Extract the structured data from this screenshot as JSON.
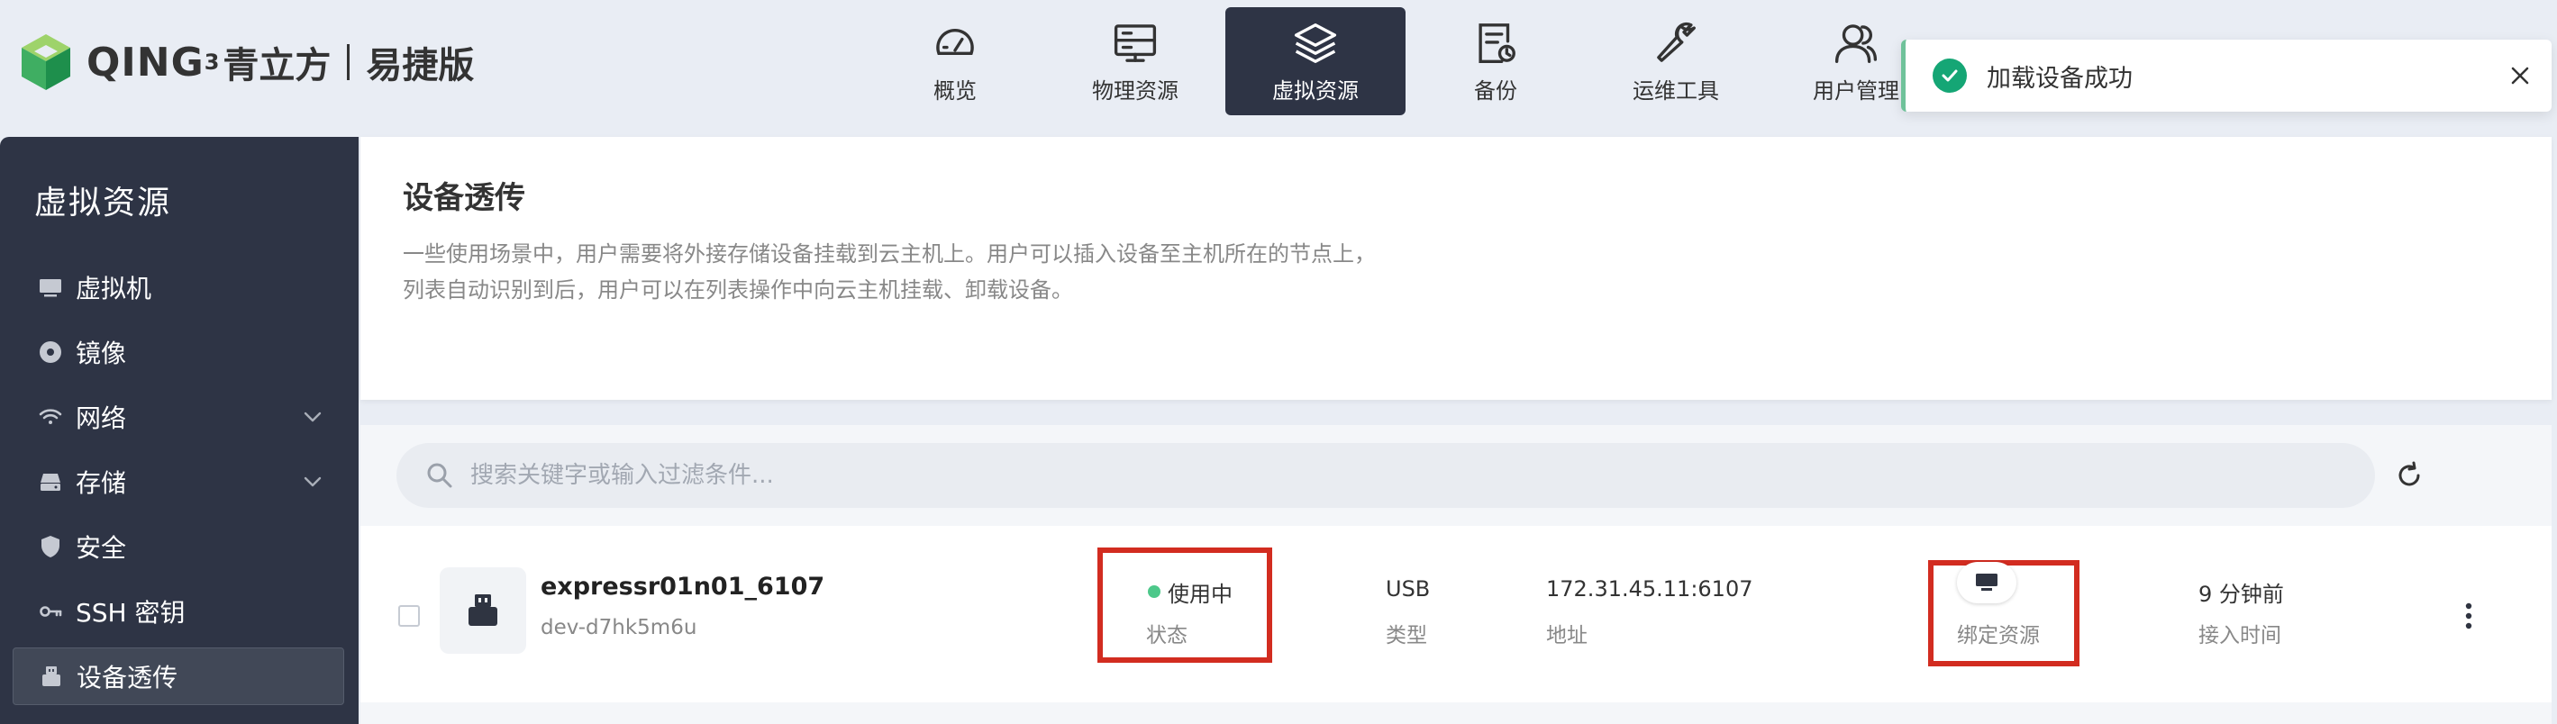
{
  "header": {
    "logo": {
      "brand": "QING",
      "sup": "3",
      "cn": "青立方",
      "edition": "易捷版"
    },
    "nav": [
      {
        "label": "概览",
        "icon": "dashboard-icon"
      },
      {
        "label": "物理资源",
        "icon": "server-icon"
      },
      {
        "label": "虚拟资源",
        "icon": "layers-icon",
        "active": true
      },
      {
        "label": "备份",
        "icon": "backup-icon"
      },
      {
        "label": "运维工具",
        "icon": "wrench-icon"
      },
      {
        "label": "用户管理",
        "icon": "users-icon"
      }
    ]
  },
  "toast": {
    "message": "加载设备成功",
    "type": "success"
  },
  "sidebar": {
    "title": "虚拟资源",
    "items": [
      {
        "label": "虚拟机",
        "icon": "monitor-icon"
      },
      {
        "label": "镜像",
        "icon": "disc-icon"
      },
      {
        "label": "网络",
        "icon": "wifi-icon",
        "expandable": true
      },
      {
        "label": "存储",
        "icon": "drive-icon",
        "expandable": true
      },
      {
        "label": "安全",
        "icon": "shield-icon"
      },
      {
        "label": "SSH 密钥",
        "icon": "key-icon"
      },
      {
        "label": "设备透传",
        "icon": "usb-device-icon",
        "active": true
      }
    ]
  },
  "page": {
    "title": "设备透传",
    "description_line1": "一些使用场景中，用户需要将外接存储设备挂载到云主机上。用户可以插入设备至主机所在的节点上，",
    "description_line2": "列表自动识别到后，用户可以在列表操作中向云主机挂载、卸载设备。"
  },
  "search": {
    "placeholder": "搜索关键字或输入过滤条件..."
  },
  "devices": [
    {
      "name": "expressr01n01_6107",
      "id": "dev-d7hk5m6u",
      "status": "使用中",
      "status_label": "状态",
      "type": "USB",
      "type_label": "类型",
      "address": "172.31.45.11:6107",
      "address_label": "地址",
      "bind_label": "绑定资源",
      "time": "9 分钟前",
      "time_label": "接入时间"
    }
  ],
  "colors": {
    "accent": "#2e3445",
    "success": "#15a675",
    "status_on": "#4dc88a",
    "highlight": "#d22c20"
  }
}
